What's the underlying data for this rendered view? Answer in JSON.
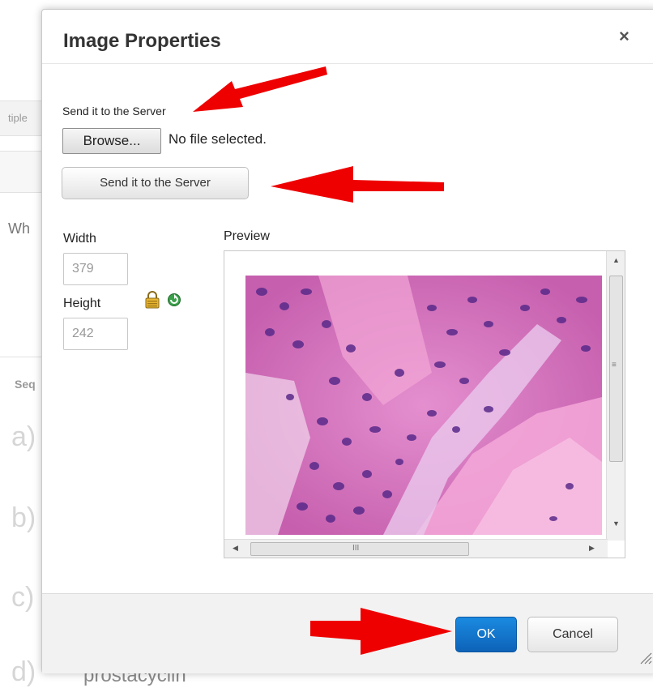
{
  "background": {
    "tab_fragment": "tiple",
    "question_fragment": "Wh",
    "section_fragment": "Seq",
    "options": [
      "a)",
      "b)",
      "c)",
      "d)"
    ],
    "bottom_text": "prostacyclin"
  },
  "dialog": {
    "title": "Image Properties",
    "close_symbol": "×",
    "upload_label": "Send it to the Server",
    "browse_label": "Browse...",
    "file_status": "No file selected.",
    "send_button": "Send it to the Server",
    "width_label": "Width",
    "width_value": "379",
    "height_label": "Height",
    "height_value": "242",
    "preview_label": "Preview",
    "scroll_grip": "≡",
    "h_grip": "III",
    "ok_label": "OK",
    "cancel_label": "Cancel"
  },
  "icons": {
    "close": "close-icon",
    "lock": "lock-icon",
    "reset": "reset-size-icon",
    "resize": "resize-grip-icon"
  },
  "colors": {
    "primary_button": "#0d63b8",
    "annotation_arrow": "#ee0000",
    "tissue_base": "#d86fb9"
  }
}
